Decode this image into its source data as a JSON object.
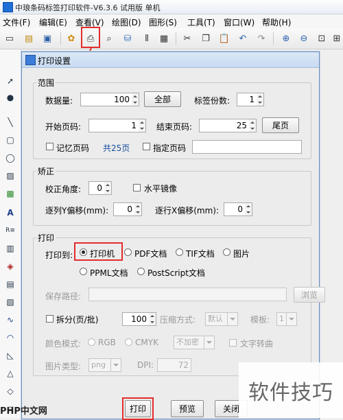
{
  "app": {
    "title": "中琅条码标签打印软件-V6.3.6 试用版 单机",
    "menus": [
      "文件(F)",
      "编辑(E)",
      "查看(V)",
      "绘图(D)",
      "图形(S)",
      "工具(T)",
      "窗口(W)",
      "帮助(H)"
    ]
  },
  "dialog": {
    "title": "打印设置",
    "range": {
      "legend": "范围",
      "data_qty_label": "数据量:",
      "data_qty_value": "100",
      "all_button": "全部",
      "copies_label": "标签份数:",
      "copies_value": "1",
      "start_page_label": "开始页码:",
      "start_page_value": "1",
      "end_page_label": "结束页码:",
      "end_page_value": "25",
      "last_page_button": "尾页",
      "remember_page_label": "记忆页码",
      "total_pages_text": "共25页",
      "specify_page_label": "指定页码",
      "specify_page_value": ""
    },
    "calibration": {
      "legend": "矫正",
      "angle_label": "校正角度:",
      "angle_value": "0",
      "mirror_label": "水平镜像",
      "col_y_offset_label": "逐列Y偏移(mm):",
      "col_y_offset_value": "0",
      "row_x_offset_label": "逐行X偏移(mm):",
      "row_x_offset_value": "0"
    },
    "print": {
      "legend": "打印",
      "print_to_label": "打印到:",
      "targets": [
        "打印机",
        "PDF文档",
        "TIF文档",
        "图片",
        "PPML文档",
        "PostScript文档"
      ],
      "selected_target": "打印机",
      "save_path_label": "保存路径:",
      "save_path_value": "",
      "browse_button": "浏览",
      "split_label": "拆分(页/批)",
      "split_value": "100",
      "compress_label": "压缩方式:",
      "compress_value": "默认",
      "mode_label": "模板:",
      "mode_value": "1",
      "color_mode_label": "颜色模式:",
      "color_rgb": "RGB",
      "color_cmyk": "CMYK",
      "color_select_value": "不加密",
      "text_outline_label": "文字转曲",
      "image_type_label": "图片类型:",
      "image_type_value": "png",
      "dpi_label": "DPI:",
      "dpi_value": "72"
    },
    "buttons": {
      "print": "打印",
      "preview": "预览",
      "close": "关闭"
    }
  },
  "watermark": {
    "text": "软件技巧",
    "logo": "PHP中文网"
  },
  "colors": {
    "highlight": "#e32b2b",
    "titlebar": "#c7daf1",
    "link": "#1a4fa0"
  }
}
